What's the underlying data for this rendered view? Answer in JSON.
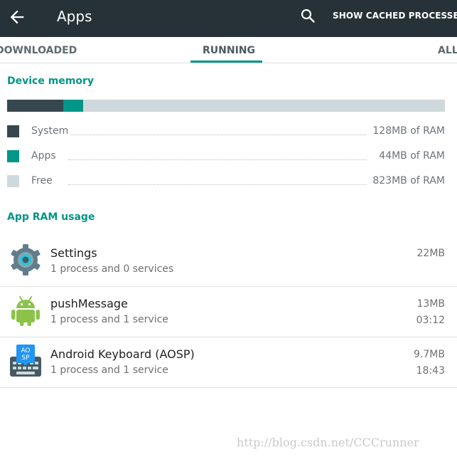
{
  "appbar": {
    "title": "Apps",
    "cached_label": "SHOW CACHED PROCESSES",
    "icons": {
      "back": "back-arrow-icon",
      "search": "search-icon"
    },
    "background": "#263238"
  },
  "tabs": [
    {
      "label": "DOWNLOADED"
    },
    {
      "label": "RUNNING",
      "selected": true
    },
    {
      "label": "ALL"
    }
  ],
  "device_memory": {
    "title": "Device memory",
    "bar": {
      "system_fraction": 0.129,
      "apps_fraction": 0.044
    },
    "legend": [
      {
        "label": "System",
        "value": "128MB of RAM",
        "color": "#37474f"
      },
      {
        "label": "Apps",
        "value": "44MB of RAM",
        "color": "#009688"
      },
      {
        "label": "Free",
        "value": "823MB of RAM",
        "color": "#cfd8dc"
      }
    ]
  },
  "app_ram": {
    "title": "App RAM usage",
    "apps": [
      {
        "name": "Settings",
        "desc": "1 process and 0 services",
        "size": "22MB",
        "time": "",
        "icon": "settings-gear-icon"
      },
      {
        "name": "pushMessage",
        "desc": "1 process and 1 service",
        "size": "13MB",
        "time": "03:12",
        "icon": "android-robot-icon"
      },
      {
        "name": "Android Keyboard (AOSP)",
        "desc": "1 process and 1 service",
        "size": "9.7MB",
        "time": "18:43",
        "icon": "keyboard-icon",
        "icon_text": [
          "AO",
          "SP"
        ]
      }
    ]
  },
  "watermark": "http://blog.csdn.net/CCCrunner",
  "accent": "#009688"
}
